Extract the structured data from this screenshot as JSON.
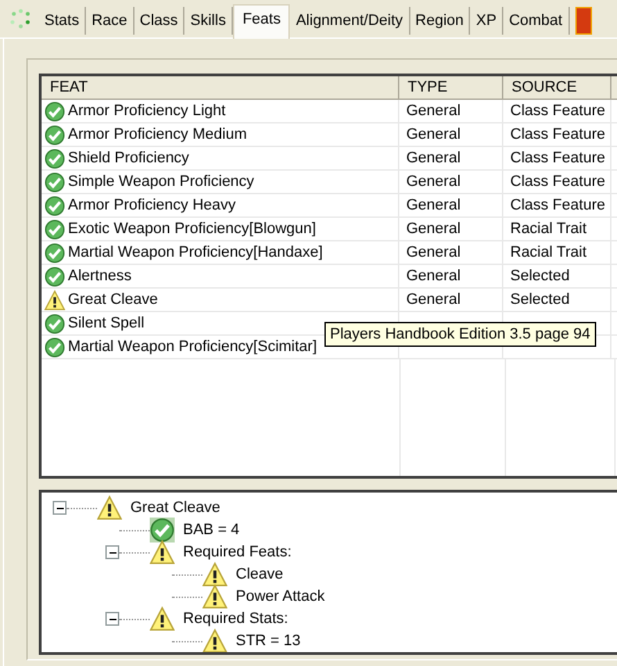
{
  "tabs": [
    {
      "label": "Stats",
      "selected": false
    },
    {
      "label": "Race",
      "selected": false
    },
    {
      "label": "Class",
      "selected": false
    },
    {
      "label": "Skills",
      "selected": false
    },
    {
      "label": "Feats",
      "selected": true
    },
    {
      "label": "Alignment/Deity",
      "selected": false
    },
    {
      "label": "Region",
      "selected": false
    },
    {
      "label": "XP",
      "selected": false
    },
    {
      "label": "Combat",
      "selected": false
    }
  ],
  "table": {
    "columns": [
      "FEAT",
      "TYPE",
      "SOURCE"
    ],
    "rows": [
      {
        "met": true,
        "cells": [
          "Armor Proficiency Light",
          "General",
          "Class Feature"
        ]
      },
      {
        "met": true,
        "cells": [
          "Armor Proficiency Medium",
          "General",
          "Class Feature"
        ]
      },
      {
        "met": true,
        "cells": [
          "Shield Proficiency",
          "General",
          "Class Feature"
        ]
      },
      {
        "met": true,
        "cells": [
          "Simple Weapon Proficiency",
          "General",
          "Class Feature"
        ]
      },
      {
        "met": true,
        "cells": [
          "Armor Proficiency Heavy",
          "General",
          "Class Feature"
        ]
      },
      {
        "met": true,
        "cells": [
          "Exotic Weapon Proficiency[Blowgun]",
          "General",
          "Racial Trait"
        ]
      },
      {
        "met": true,
        "cells": [
          "Martial Weapon Proficiency[Handaxe]",
          "General",
          "Racial Trait"
        ]
      },
      {
        "met": true,
        "cells": [
          "Alertness",
          "General",
          "Selected"
        ]
      },
      {
        "met": false,
        "cells": [
          "Great Cleave",
          "General",
          "Selected"
        ]
      },
      {
        "met": true,
        "cells": [
          "Silent Spell"
        ]
      },
      {
        "met": true,
        "cells": [
          "Martial Weapon Proficiency[Scimitar]"
        ]
      }
    ]
  },
  "tooltip": "Players Handbook Edition 3.5 page 94",
  "tree": [
    {
      "label": "Great Cleave",
      "met": false,
      "expanded": true,
      "children": [
        {
          "label": "BAB = 4",
          "met": true
        },
        {
          "label": "Required Feats:",
          "met": false,
          "expanded": true,
          "children": [
            {
              "label": "Cleave",
              "met": false
            },
            {
              "label": "Power Attack",
              "met": false
            }
          ]
        },
        {
          "label": "Required Stats:",
          "met": false,
          "expanded": true,
          "children": [
            {
              "label": "STR = 13",
              "met": false
            }
          ]
        }
      ]
    }
  ]
}
